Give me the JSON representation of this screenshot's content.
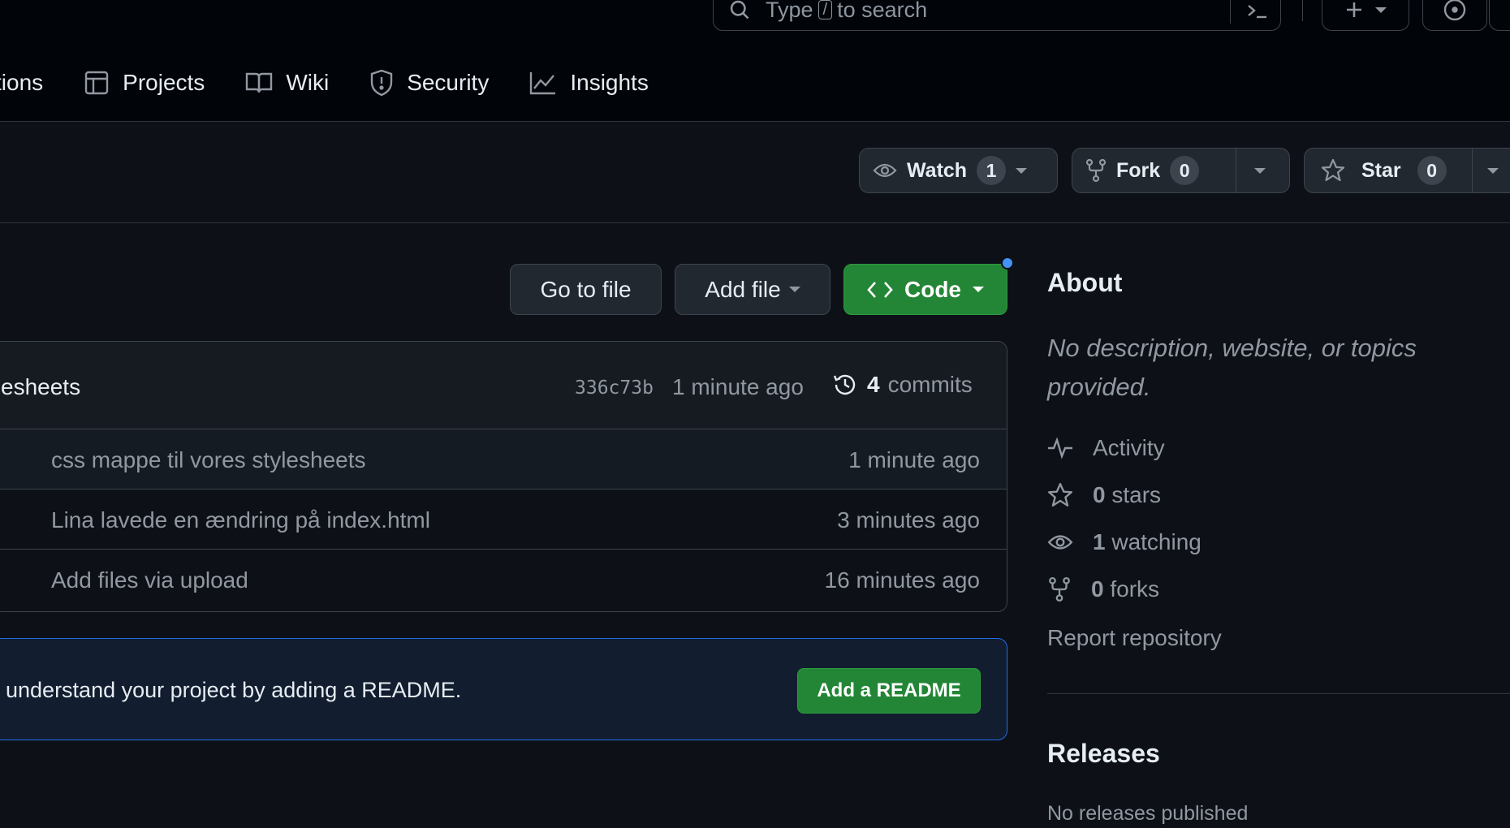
{
  "header": {
    "search": {
      "prefix": "Type",
      "key": "/",
      "suffix": "to search"
    }
  },
  "nav": [
    {
      "label": "tions",
      "icon": "play-icon"
    },
    {
      "label": "Projects",
      "icon": "table-icon"
    },
    {
      "label": "Wiki",
      "icon": "book-icon"
    },
    {
      "label": "Security",
      "icon": "shield-icon"
    },
    {
      "label": "Insights",
      "icon": "graph-icon"
    }
  ],
  "repo_actions": {
    "watch": {
      "label": "Watch",
      "count": "1"
    },
    "fork": {
      "label": "Fork",
      "count": "0"
    },
    "star": {
      "label": "Star",
      "count": "0"
    }
  },
  "file_actions": {
    "goto": "Go to file",
    "add": "Add file",
    "code": "Code"
  },
  "latest_commit": {
    "message": "esheets",
    "sha": "336c73b",
    "ago": "1 minute ago",
    "commit_count": "4",
    "commits_label": "commits"
  },
  "files": [
    {
      "message": "css mappe til vores stylesheets",
      "time": "1 minute ago"
    },
    {
      "message": "Lina lavede en ændring på index.html",
      "time": "3 minutes ago"
    },
    {
      "message": "Add files via upload",
      "time": "16 minutes ago"
    }
  ],
  "readme_banner": {
    "text": "understand your project by adding a README.",
    "button": "Add a README"
  },
  "about": {
    "title": "About",
    "description": "No description, website, or topics provided.",
    "activity": "Activity",
    "stars_count": "0",
    "stars_label": "stars",
    "watching_count": "1",
    "watching_label": "watching",
    "forks_count": "0",
    "forks_label": "forks",
    "report": "Report repository"
  },
  "releases": {
    "title": "Releases",
    "empty": "No releases published"
  },
  "colors": {
    "background": "#0d1117",
    "header": "#010409",
    "accent_green": "#238636",
    "accent_blue": "#4493f8",
    "muted_text": "#9198a1"
  }
}
